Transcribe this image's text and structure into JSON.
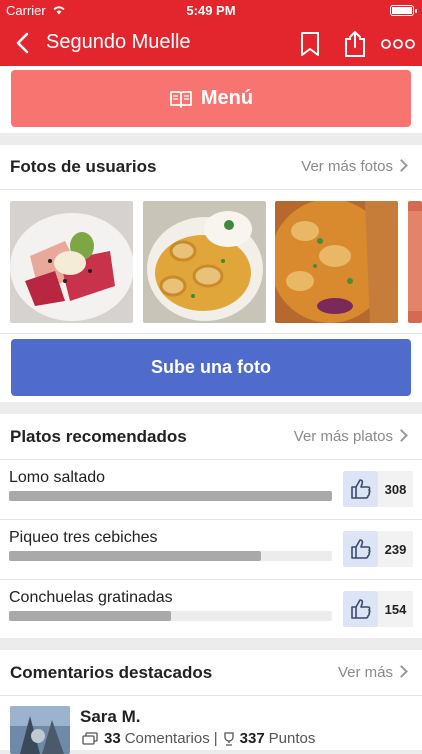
{
  "status_bar": {
    "carrier": "Carrier",
    "time": "5:49 PM"
  },
  "navbar": {
    "title": "Segundo Muelle"
  },
  "menu_button": {
    "label": "Menú"
  },
  "user_photos": {
    "title": "Fotos de usuarios",
    "link": "Ver más fotos",
    "upload_label": "Sube una foto"
  },
  "recommended": {
    "title": "Platos recomendados",
    "link": "Ver más platos",
    "dishes": [
      {
        "name": "Lomo saltado",
        "votes": "308",
        "level": 1.0
      },
      {
        "name": "Piqueo tres cebiches",
        "votes": "239",
        "level": 0.78
      },
      {
        "name": "Conchuelas gratinadas",
        "votes": "154",
        "level": 0.5
      }
    ]
  },
  "comments": {
    "title": "Comentarios destacados",
    "link": "Ver más",
    "user": {
      "name": "Sara M.",
      "comments_count": "33",
      "comments_label": "Comentarios",
      "separator": "|",
      "points_count": "337",
      "points_label": "Puntos"
    }
  },
  "colors": {
    "brand_red": "#e3262d",
    "menu_button": "#f87470",
    "upload_button": "#4f6bcb"
  }
}
